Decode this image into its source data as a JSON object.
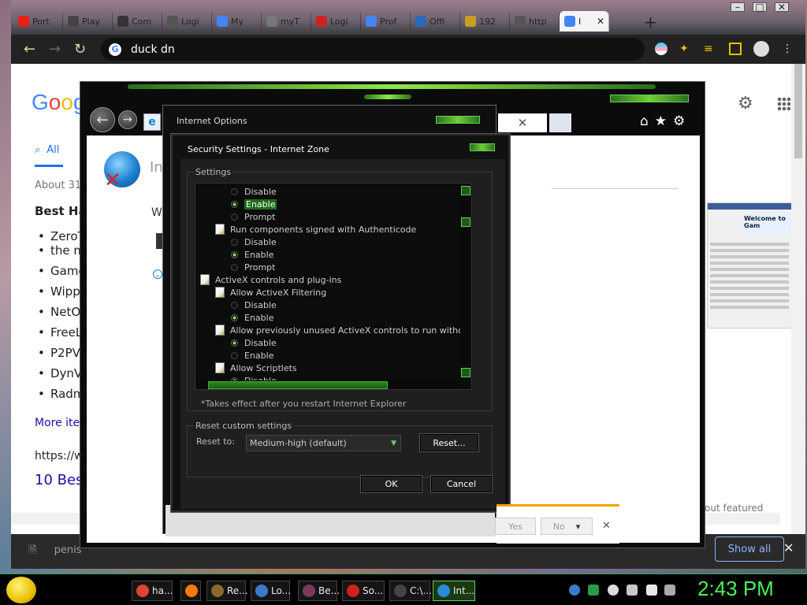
{
  "browser": {
    "tabs": [
      {
        "label": "Port",
        "fav_color": "#e62117"
      },
      {
        "label": "Play",
        "fav_color": "#444444"
      },
      {
        "label": "Com",
        "fav_color": "#333333"
      },
      {
        "label": "Logi",
        "fav_color": "#555555"
      },
      {
        "label": "My",
        "fav_color": "#4285f4"
      },
      {
        "label": "myT",
        "fav_color": "#777777"
      },
      {
        "label": "Logi",
        "fav_color": "#cc2222"
      },
      {
        "label": "Prof",
        "fav_color": "#4285f4"
      },
      {
        "label": "Offi",
        "fav_color": "#2a6ab8"
      },
      {
        "label": "192",
        "fav_color": "#c8a020"
      },
      {
        "label": "http",
        "fav_color": "#555555"
      },
      {
        "label": "I",
        "fav_color": "#4285f4"
      }
    ],
    "new_tab": "+",
    "address": "duck dn"
  },
  "google": {
    "logo": "Goog",
    "tab_all": "All",
    "about": "About 31",
    "best": "Best Ha",
    "list": [
      "ZeroT",
      "the m",
      "Game",
      "Wipp",
      "NetO",
      "FreeL",
      "P2PV",
      "DynV",
      "Radm"
    ],
    "more_items": "More iter",
    "url": "https://w",
    "result_title": "10 Bes",
    "featured": "out featured snippets",
    "welcome": "Welcome to Gam"
  },
  "download": {
    "file": "penis",
    "show_all": "Show all",
    "close": "✕"
  },
  "ie": {
    "title_partial": "In",
    "w_text": "W",
    "addr_close": "✕"
  },
  "internet_options": {
    "title": "Internet Options"
  },
  "security": {
    "title": "Security Settings - Internet Zone",
    "settings_label": "Settings",
    "tree": [
      {
        "type": "radio",
        "indent": 2,
        "label": "Disable",
        "on": false,
        "selected": false
      },
      {
        "type": "radio",
        "indent": 2,
        "label": "Enable",
        "on": true,
        "selected": true
      },
      {
        "type": "radio",
        "indent": 2,
        "label": "Prompt",
        "on": false,
        "selected": false
      },
      {
        "type": "item",
        "indent": 1,
        "label": "Run components signed with Authenticode",
        "icon": "ie"
      },
      {
        "type": "radio",
        "indent": 2,
        "label": "Disable",
        "on": false,
        "selected": false
      },
      {
        "type": "radio",
        "indent": 2,
        "label": "Enable",
        "on": true,
        "selected": false
      },
      {
        "type": "radio",
        "indent": 2,
        "label": "Prompt",
        "on": false,
        "selected": false
      },
      {
        "type": "item",
        "indent": 0,
        "label": "ActiveX controls and plug-ins",
        "icon": "doc"
      },
      {
        "type": "item",
        "indent": 1,
        "label": "Allow ActiveX Filtering",
        "icon": "doc"
      },
      {
        "type": "radio",
        "indent": 2,
        "label": "Disable",
        "on": false,
        "selected": false
      },
      {
        "type": "radio",
        "indent": 2,
        "label": "Enable",
        "on": true,
        "selected": false
      },
      {
        "type": "item",
        "indent": 1,
        "label": "Allow previously unused ActiveX controls to run without prom",
        "icon": "doc"
      },
      {
        "type": "radio",
        "indent": 2,
        "label": "Disable",
        "on": true,
        "selected": false
      },
      {
        "type": "radio",
        "indent": 2,
        "label": "Enable",
        "on": false,
        "selected": false
      },
      {
        "type": "item",
        "indent": 1,
        "label": "Allow Scriptlets",
        "icon": "doc"
      },
      {
        "type": "radio",
        "indent": 2,
        "label": "Disable",
        "on": true,
        "selected": false
      }
    ],
    "takes_effect": "*Takes effect after you restart Internet Explorer",
    "reset_group": "Reset custom settings",
    "reset_to_label": "Reset to:",
    "reset_value": "Medium-high (default)",
    "reset_button": "Reset...",
    "ok": "OK",
    "cancel": "Cancel"
  },
  "notification": {
    "yes": "Yes",
    "no": "No",
    "close": "✕"
  },
  "taskbar": {
    "tasks": [
      {
        "label": "ha...",
        "color": "#dd4433"
      },
      {
        "label": "",
        "color": "#ff7a00"
      },
      {
        "label": "Re...",
        "color": "#8a6a2a"
      },
      {
        "label": "Lo...",
        "color": "#3a7ac8"
      },
      {
        "label": "Be...",
        "color": "#7a3a5a"
      },
      {
        "label": "So...",
        "color": "#d02020"
      },
      {
        "label": "C:\\...",
        "color": "#444444"
      },
      {
        "label": "Int...",
        "color": "#2a8ad8"
      }
    ],
    "clock": "2:43 PM"
  }
}
